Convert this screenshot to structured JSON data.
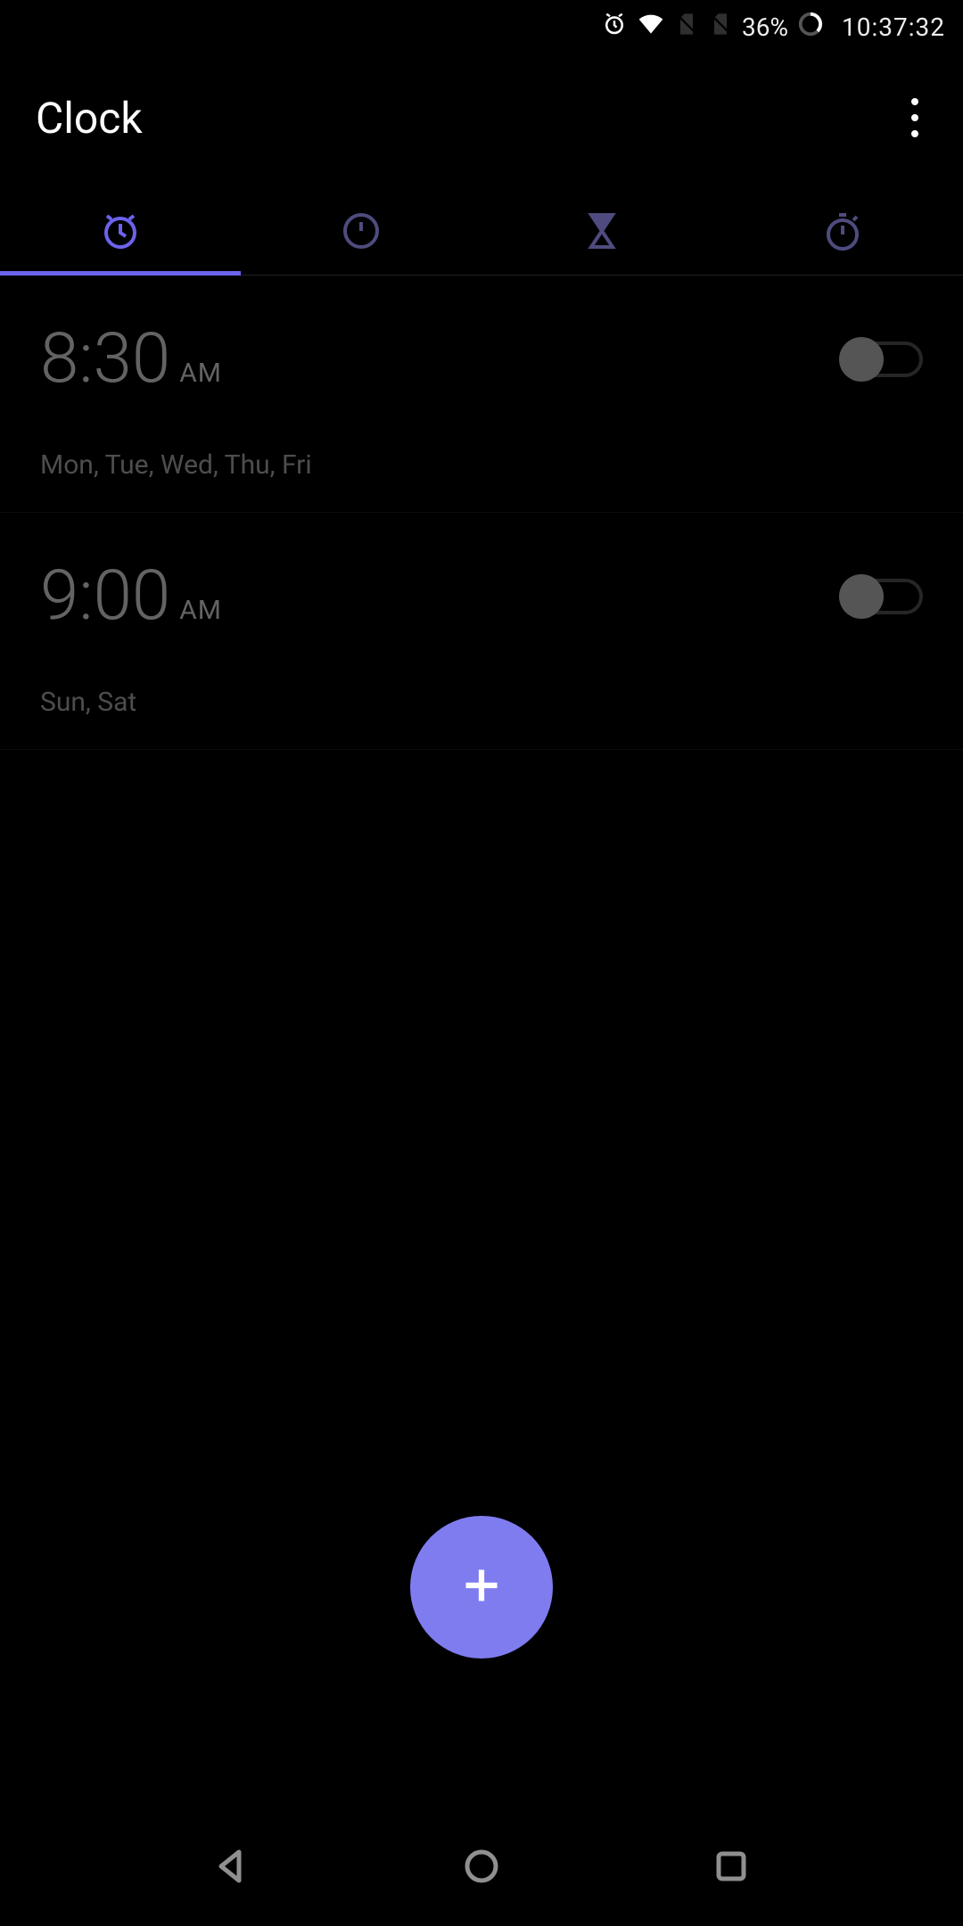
{
  "status_bar": {
    "battery_pct": "36%",
    "time": "10:37:32"
  },
  "header": {
    "title": "Clock"
  },
  "tabs": {
    "active_index": 0,
    "items": [
      {
        "name": "alarm"
      },
      {
        "name": "clock"
      },
      {
        "name": "timer"
      },
      {
        "name": "stopwatch"
      }
    ]
  },
  "alarms": [
    {
      "time": "8:30",
      "ampm": "AM",
      "days": "Mon, Tue, Wed, Thu, Fri",
      "enabled": false
    },
    {
      "time": "9:00",
      "ampm": "AM",
      "days": "Sun, Sat",
      "enabled": false
    }
  ],
  "colors": {
    "accent": "#6b63ec",
    "fab": "#7f7cf0"
  }
}
